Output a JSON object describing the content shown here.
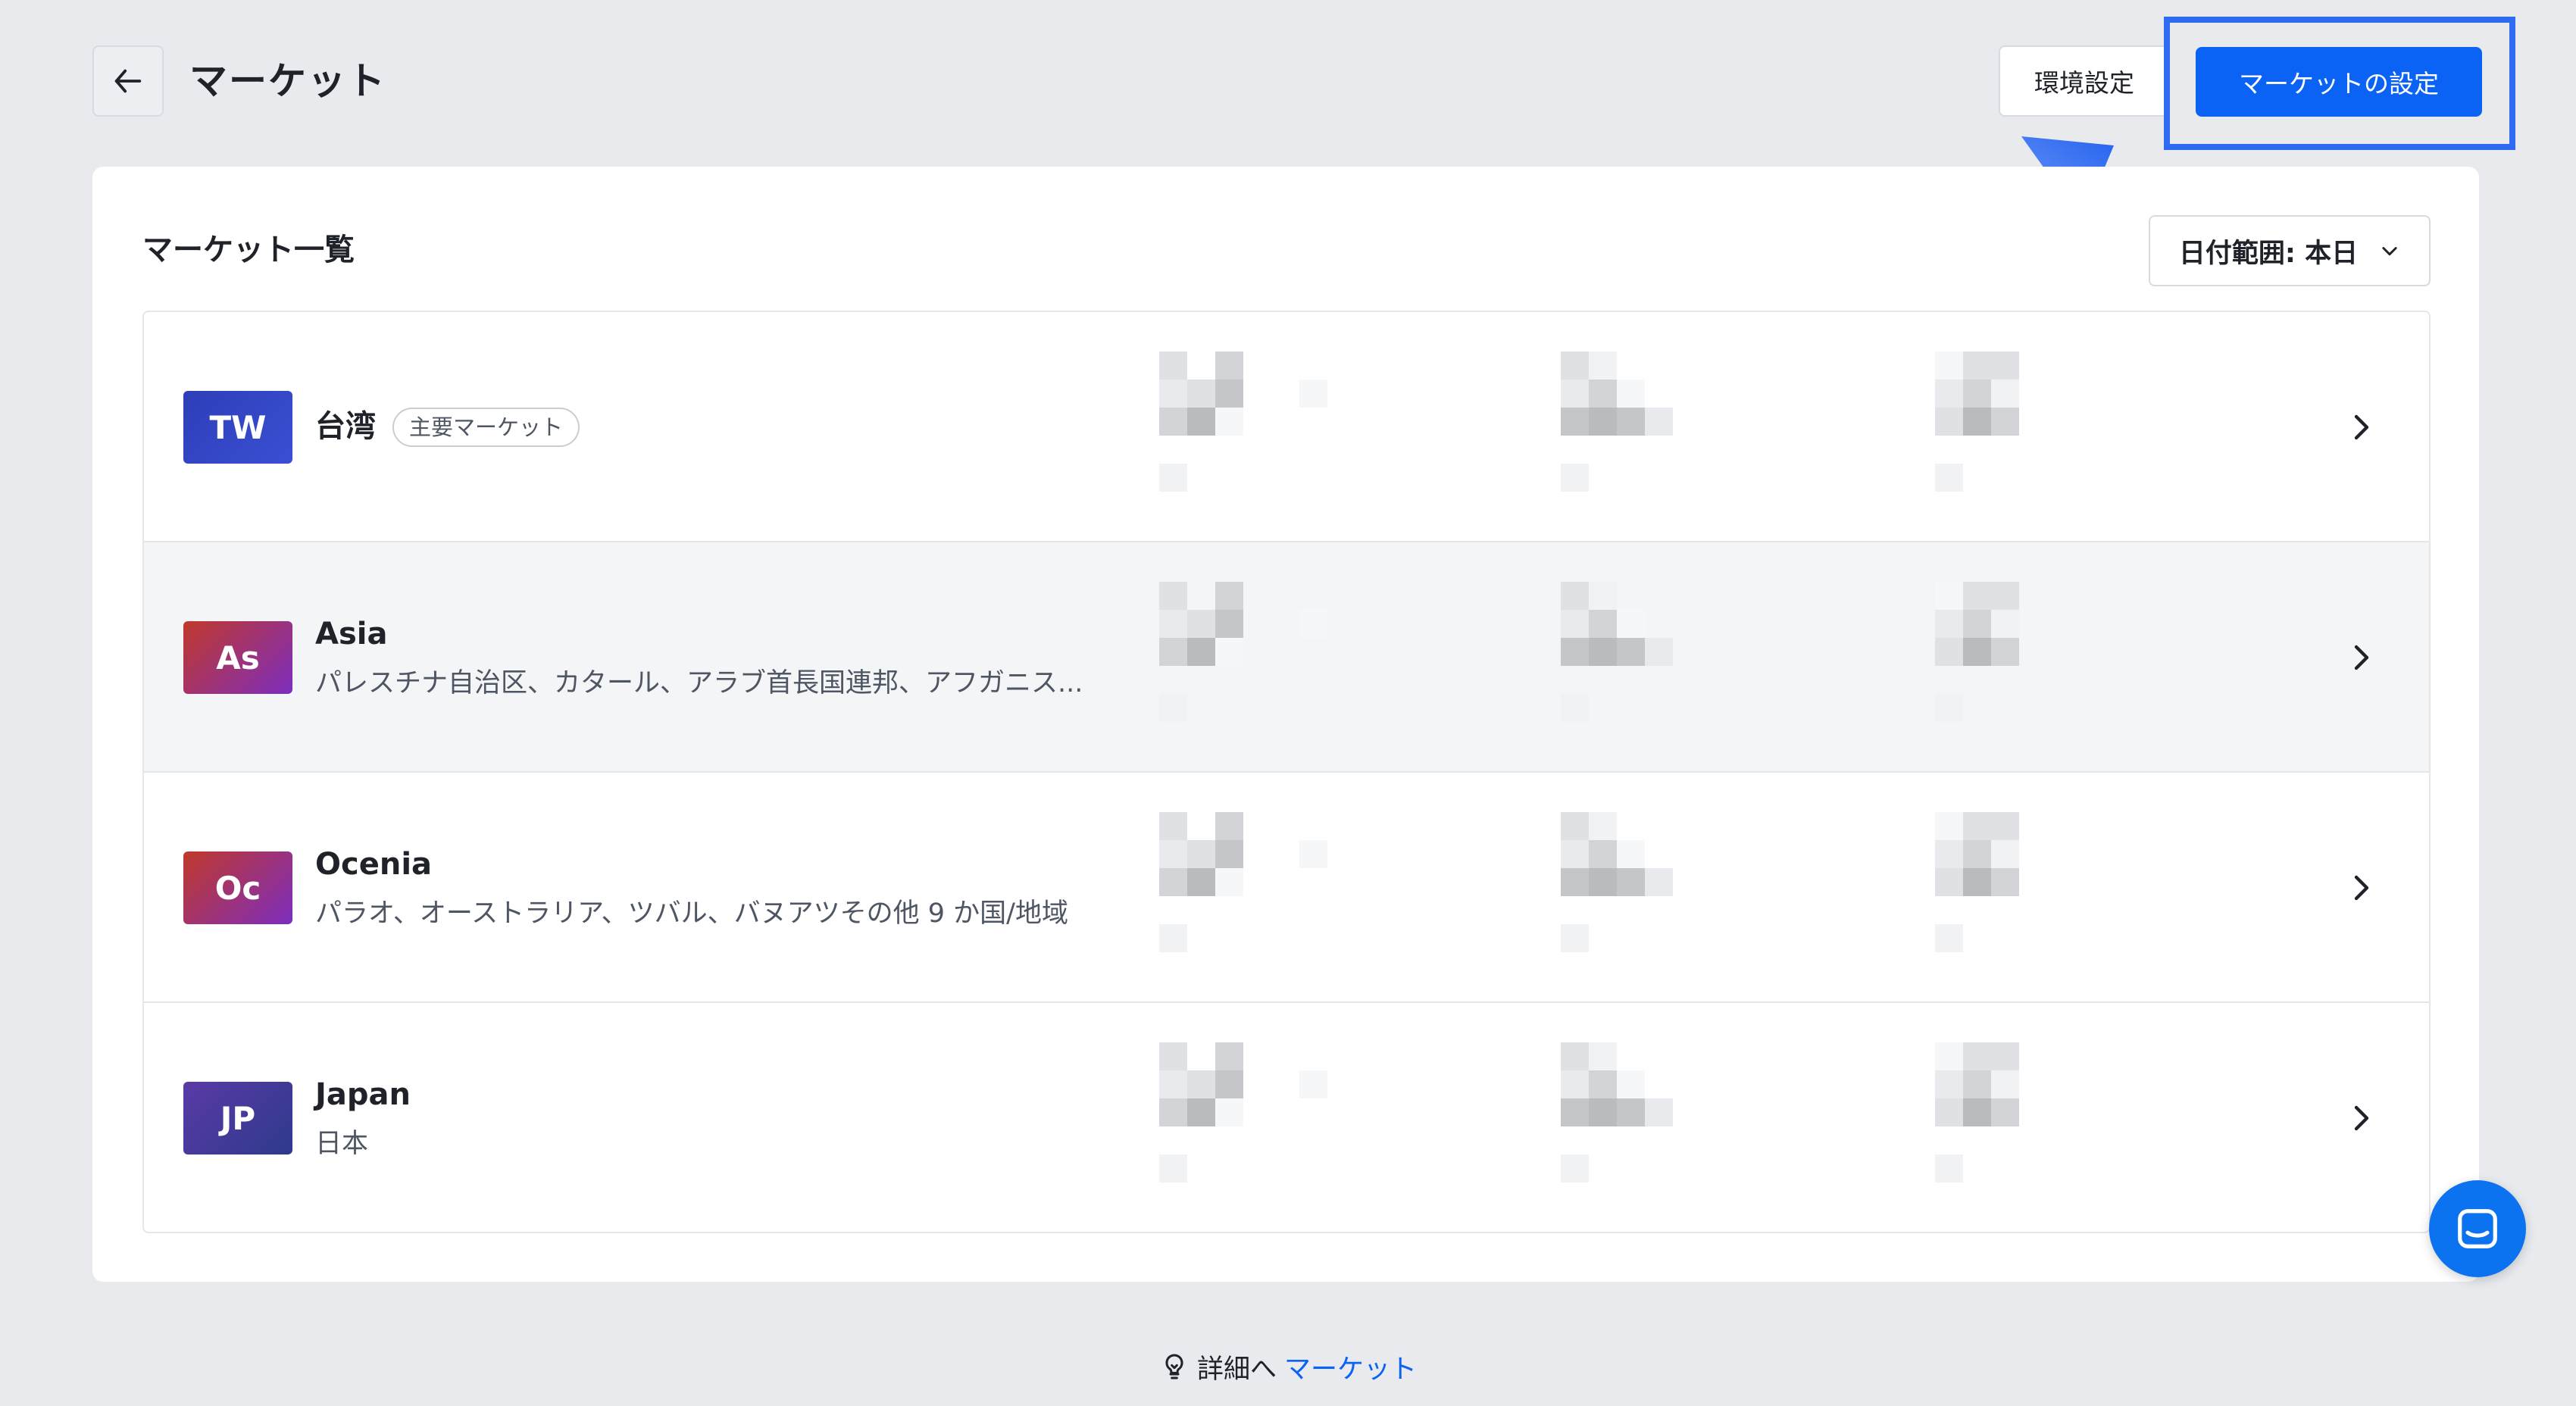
{
  "header": {
    "title": "マーケット",
    "environment_button": "環境設定",
    "market_settings_button": "マーケットの設定"
  },
  "card": {
    "title": "マーケット一覧",
    "date_range_label": "日付範囲: 本日"
  },
  "markets": [
    {
      "code": "TW",
      "name": "台湾",
      "tag": "主要マーケット",
      "subtitle": "",
      "badge_colors": [
        "#2d3eb8",
        "#3a4fd4"
      ]
    },
    {
      "code": "As",
      "name": "Asia",
      "tag": "",
      "subtitle": "パレスチナ自治区、カタール、アラブ首長国連邦、アフガニス...",
      "badge_colors": [
        "#c0392b",
        "#7d2dbf"
      ]
    },
    {
      "code": "Oc",
      "name": "Ocenia",
      "tag": "",
      "subtitle": "パラオ、オーストラリア、ツバル、バヌアツその他 9 か国/地域",
      "badge_colors": [
        "#c0392b",
        "#7d2dbf"
      ]
    },
    {
      "code": "JP",
      "name": "Japan",
      "tag": "",
      "subtitle": "日本",
      "badge_colors": [
        "#5a3aa6",
        "#2d3a8c"
      ]
    }
  ],
  "footer": {
    "prefix": "詳細へ",
    "link": "マーケット"
  },
  "icons": {
    "back": "arrow-left-icon",
    "dropdown": "chevron-down-icon",
    "row_chevron": "chevron-right-icon",
    "footer": "lightbulb-icon",
    "chat": "chat-icon"
  },
  "colors": {
    "accent": "#0b63f6",
    "highlight": "#2f6bf2",
    "background": "#e8eaee"
  }
}
